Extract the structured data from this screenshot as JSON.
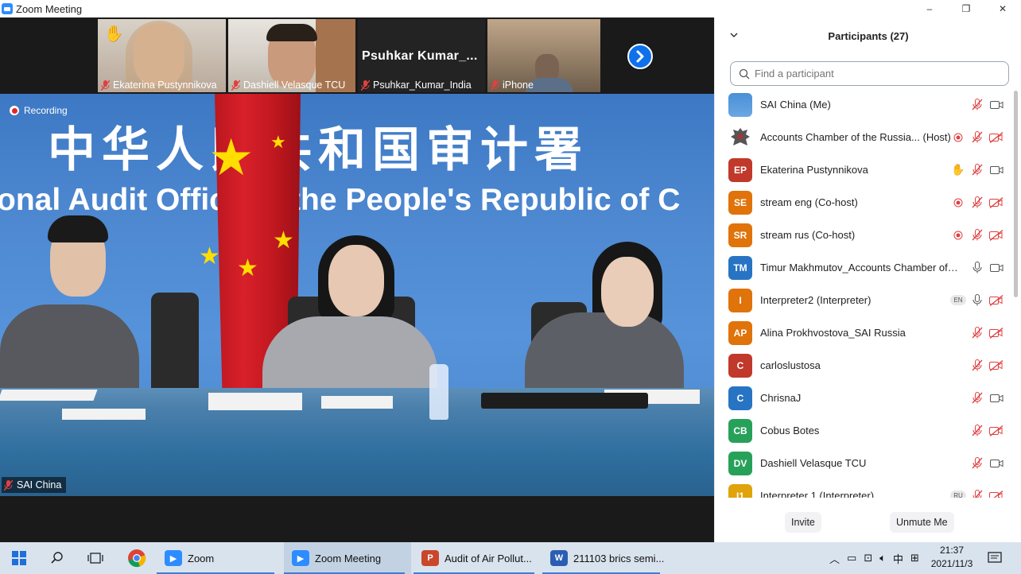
{
  "window": {
    "title": "Zoom Meeting",
    "controls": {
      "minimize": "–",
      "restore": "❐",
      "close": "✕"
    }
  },
  "gallery": {
    "tiles": [
      {
        "name": "Ekaterina Pustynnikova",
        "raised_hand": "✋"
      },
      {
        "name": "Dashiell Velasque TCU"
      },
      {
        "name": "Psuhkar_Kumar_India",
        "big_label": "Psuhkar  Kumar_..."
      },
      {
        "name": "iPhone"
      }
    ]
  },
  "main_video": {
    "recording_label": "Recording",
    "banner_cn": "中华人民共和国审计署",
    "banner_en": "onal Audit Office of the People's Republic of C",
    "speaker_name": "SAI China"
  },
  "participants": {
    "title": "Participants (27)",
    "search_placeholder": "Find a participant",
    "list": [
      {
        "initials": "",
        "name": "SAI China (Me)",
        "color": "#5b9bd5",
        "type": "image",
        "rec": false,
        "hand": false,
        "lang": "",
        "mic": "muted",
        "video": "on"
      },
      {
        "initials": "",
        "name": "Accounts Chamber of the Russia... (Host)",
        "color": "#ffffff",
        "type": "emblem",
        "rec": true,
        "hand": false,
        "lang": "",
        "mic": "muted",
        "video": "off"
      },
      {
        "initials": "EP",
        "name": "Ekaterina Pustynnikova",
        "color": "#c0392b",
        "type": "initials",
        "rec": false,
        "hand": true,
        "lang": "",
        "mic": "muted",
        "video": "on"
      },
      {
        "initials": "SE",
        "name": "stream eng (Co-host)",
        "color": "#e0730a",
        "type": "initials",
        "rec": true,
        "hand": false,
        "lang": "",
        "mic": "muted",
        "video": "off"
      },
      {
        "initials": "SR",
        "name": "stream rus (Co-host)",
        "color": "#e0730a",
        "type": "initials",
        "rec": true,
        "hand": false,
        "lang": "",
        "mic": "muted",
        "video": "off"
      },
      {
        "initials": "TM",
        "name": "Timur Makhmutov_Accounts Chamber of th...",
        "color": "#2874c4",
        "type": "initials",
        "rec": false,
        "hand": false,
        "lang": "",
        "mic": "on",
        "video": "on"
      },
      {
        "initials": "I",
        "name": "Interpreter2 (Interpreter)",
        "color": "#e0730a",
        "type": "initials",
        "rec": false,
        "hand": false,
        "lang": "EN",
        "mic": "on",
        "video": "off"
      },
      {
        "initials": "AP",
        "name": "Alina Prokhvostova_SAI Russia",
        "color": "#e0730a",
        "type": "initials",
        "rec": false,
        "hand": false,
        "lang": "",
        "mic": "muted",
        "video": "off"
      },
      {
        "initials": "C",
        "name": "carloslustosa",
        "color": "#c0392b",
        "type": "initials",
        "rec": false,
        "hand": false,
        "lang": "",
        "mic": "muted",
        "video": "off"
      },
      {
        "initials": "C",
        "name": "ChrisnaJ",
        "color": "#2874c4",
        "type": "initials",
        "rec": false,
        "hand": false,
        "lang": "",
        "mic": "muted",
        "video": "on"
      },
      {
        "initials": "CB",
        "name": "Cobus Botes",
        "color": "#27a15a",
        "type": "initials",
        "rec": false,
        "hand": false,
        "lang": "",
        "mic": "muted",
        "video": "off"
      },
      {
        "initials": "DV",
        "name": "Dashiell Velasque TCU",
        "color": "#27a15a",
        "type": "initials",
        "rec": false,
        "hand": false,
        "lang": "",
        "mic": "muted",
        "video": "on"
      },
      {
        "initials": "I1",
        "name": "Interpreter 1 (Interpreter)",
        "color": "#e0a30a",
        "type": "initials",
        "rec": false,
        "hand": false,
        "lang": "RU",
        "mic": "muted",
        "video": "off"
      }
    ],
    "invite_label": "Invite",
    "unmute_label": "Unmute Me"
  },
  "taskbar": {
    "apps": [
      {
        "label": "Zoom",
        "icon": "zoom-icon",
        "color": "#2d8cff",
        "glyph": "▶"
      },
      {
        "label": "Zoom Meeting",
        "icon": "zoom-icon",
        "color": "#2d8cff",
        "glyph": "▶"
      },
      {
        "label": "Audit of Air Pollut...",
        "icon": "powerpoint-icon",
        "color": "#c8472b",
        "glyph": "P"
      },
      {
        "label": "211103 brics semi...",
        "icon": "word-icon",
        "color": "#2b5eb3",
        "glyph": "W"
      }
    ],
    "ime": "中",
    "time": "21:37",
    "date": "2021/11/3"
  }
}
